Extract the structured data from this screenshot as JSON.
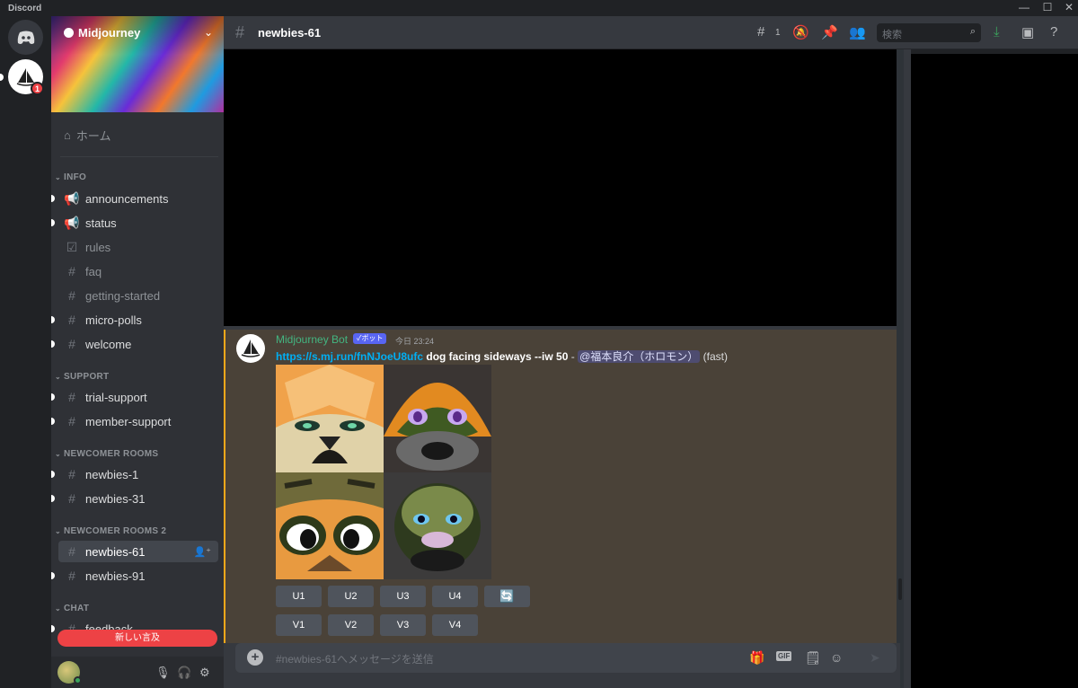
{
  "app": {
    "title": "Discord",
    "window_controls": [
      "—",
      "☐",
      "✕"
    ]
  },
  "guilds": {
    "badge": "1"
  },
  "server": {
    "name": "Midjourney",
    "home_label": "ホーム"
  },
  "categories": {
    "info": "INFO",
    "support": "SUPPORT",
    "newcomer": "NEWCOMER ROOMS",
    "newcomer2": "NEWCOMER ROOMS 2",
    "chat": "CHAT"
  },
  "channels": {
    "announcements": "announcements",
    "status": "status",
    "rules": "rules",
    "faq": "faq",
    "getting_started": "getting-started",
    "micro_polls": "micro-polls",
    "welcome": "welcome",
    "trial_support": "trial-support",
    "member_support": "member-support",
    "newbies_1": "newbies-1",
    "newbies_31": "newbies-31",
    "newbies_61": "newbies-61",
    "newbies_91": "newbies-91",
    "feedback": "feedback"
  },
  "new_mention_label": "新しい言及",
  "header": {
    "channel": "newbies-61",
    "threads_count": "1",
    "search_placeholder": "検索"
  },
  "message": {
    "author": "Midjourney Bot",
    "bot_tag": "✓ボット",
    "timestamp": "今日 23:24",
    "link": "https://s.mj.run/fnNJoeU8ufc",
    "prompt": "dog facing sideways --iw 50",
    "separator": " - ",
    "mention": "@福本良介（ホロモン）",
    "mode": "(fast)",
    "upscale_buttons": [
      "U1",
      "U2",
      "U3",
      "U4"
    ],
    "variation_buttons": [
      "V1",
      "V2",
      "V3",
      "V4"
    ],
    "reroll_icon": "🔄"
  },
  "composer": {
    "placeholder": "#newbies-61へメッセージを送信",
    "gif_label": "GIF"
  }
}
